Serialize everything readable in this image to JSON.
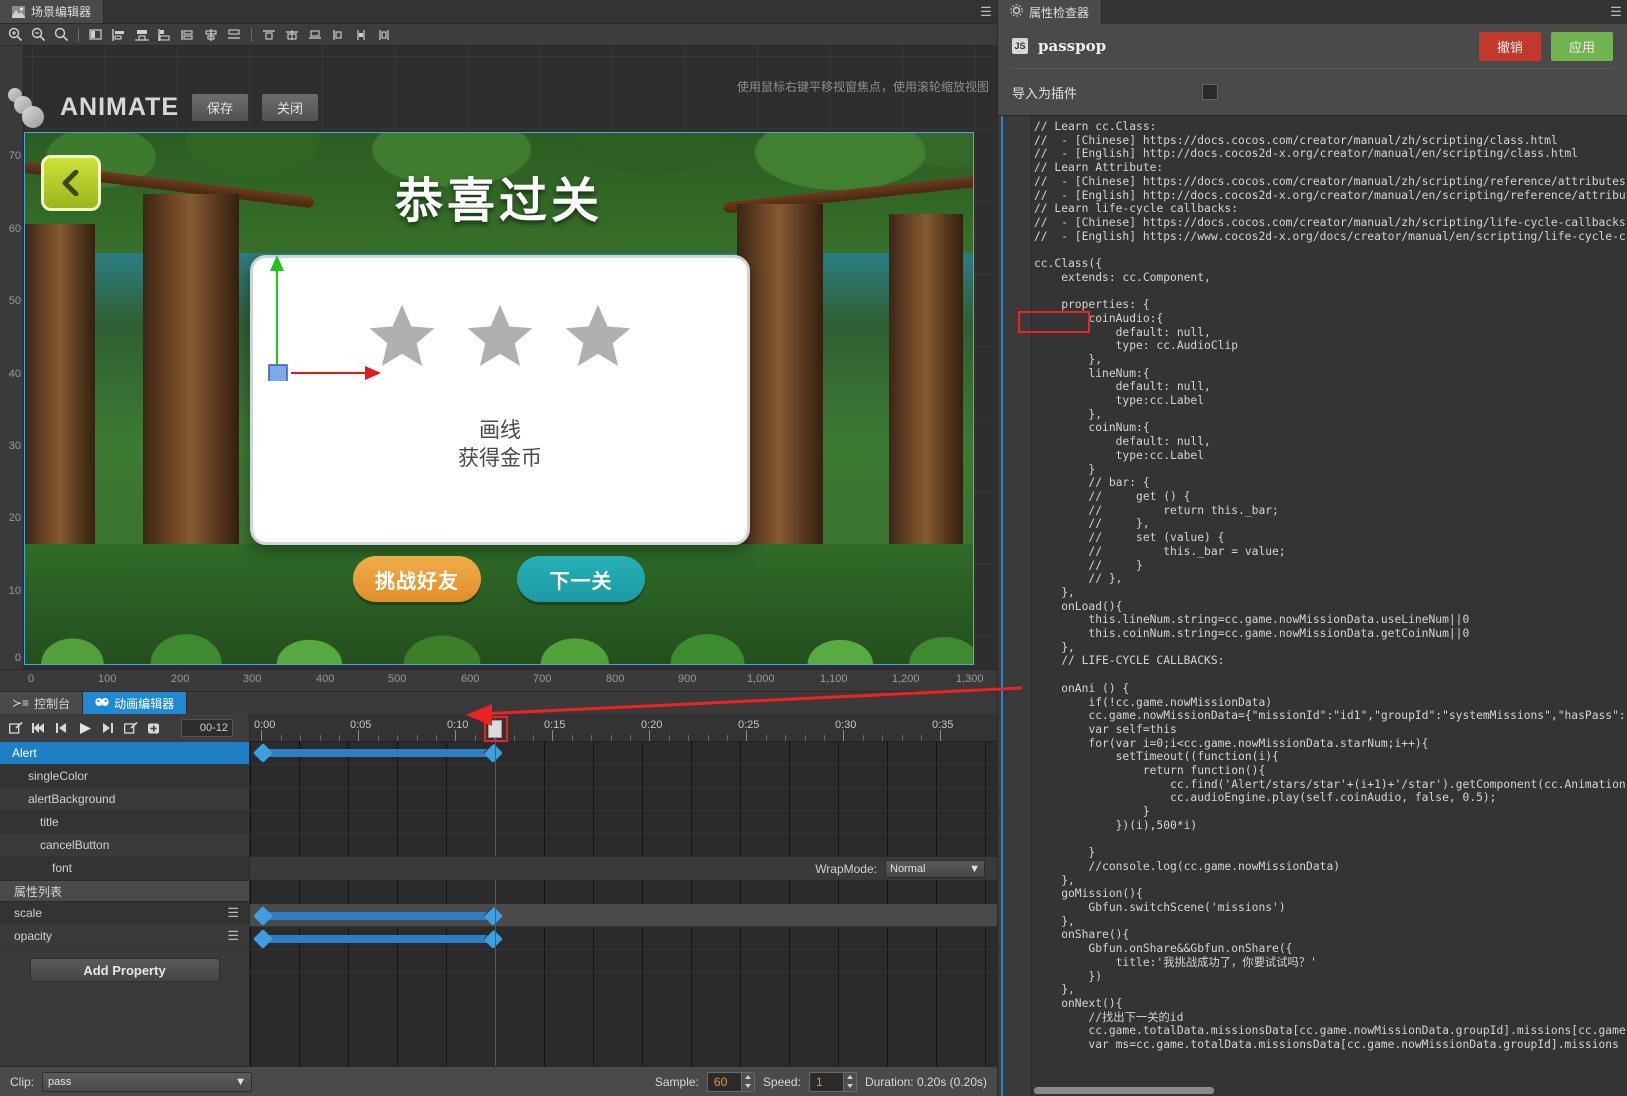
{
  "scene_panel": {
    "tab_label": "场景编辑器",
    "tab_icon": "scene-icon",
    "menu_icon": "hamburger-icon",
    "toolbar_icons": [
      "zoom-in-icon",
      "zoom-out-icon",
      "zoom-reset-icon",
      "align-left-edge-icon",
      "align-left-icon",
      "align-center-horizontal-icon",
      "align-right-icon",
      "align-top-icon",
      "align-middle-icon",
      "align-bottom-icon",
      "distribute-left-icon",
      "distribute-center-icon",
      "distribute-right-icon",
      "distribute-top-icon",
      "distribute-middle-icon",
      "distribute-bottom-icon"
    ],
    "hint_text": "使用鼠标右键平移视窗焦点，使用滚轮缩放视图",
    "animate_label": "ANIMATE",
    "save_label": "保存",
    "close_label": "关闭",
    "vertical_ruler": [
      "70",
      "60",
      "50",
      "40",
      "30",
      "20",
      "10",
      "0"
    ],
    "horizontal_ruler": [
      "0",
      "100",
      "200",
      "300",
      "400",
      "500",
      "600",
      "700",
      "800",
      "900",
      "1,000",
      "1,100",
      "1,200",
      "1,300"
    ]
  },
  "game_preview": {
    "back_button_icon": "back-arrow-icon",
    "title": "恭喜过关",
    "card_line1": "画线",
    "card_line2": "获得金币",
    "stars": 3,
    "star_color": "#b0b0b0",
    "button_challenge": "挑战好友",
    "button_next": "下一关",
    "button_challenge_color": "#eca03a",
    "button_next_color": "#22a8b0",
    "gizmo": {
      "y_axis_color": "#22c220",
      "x_axis_color": "#e01b1b",
      "handle_color": "#7ea8e8"
    }
  },
  "bottom_tabs": [
    {
      "label": "控制台",
      "icon": "console-icon",
      "active": false
    },
    {
      "label": "动画编辑器",
      "icon": "animation-icon",
      "active": true
    }
  ],
  "timeline": {
    "controls": [
      "edit-icon",
      "skip-to-start-icon",
      "prev-frame-icon",
      "play-icon",
      "next-frame-icon",
      "popout-icon",
      "add-keyframe-icon"
    ],
    "frame_field": "00-12",
    "nodes": [
      {
        "label": "Alert",
        "indent": 0,
        "selected": true
      },
      {
        "label": "singleColor",
        "indent": 1,
        "selected": false
      },
      {
        "label": "alertBackground",
        "indent": 1,
        "selected": false
      },
      {
        "label": "title",
        "indent": 2,
        "selected": false
      },
      {
        "label": "cancelButton",
        "indent": 2,
        "selected": false
      },
      {
        "label": "font",
        "indent": 3,
        "selected": false
      }
    ],
    "property_list_header": "属性列表",
    "properties": [
      {
        "label": "scale",
        "menu_icon": "drag-handle-icon"
      },
      {
        "label": "opacity",
        "menu_icon": "drag-handle-icon"
      }
    ],
    "add_property_label": "Add Property",
    "ruler_labels": [
      "0:00",
      "0:05",
      "0:10",
      "0:15",
      "0:20",
      "0:25",
      "0:30",
      "0:35"
    ],
    "wrapmode_label": "WrapMode:",
    "wrapmode_value": "Normal",
    "playhead_time": "0:10"
  },
  "statusbar": {
    "clip_label": "Clip:",
    "clip_value": "pass",
    "sample_label": "Sample:",
    "sample_value": "60",
    "speed_label": "Speed:",
    "speed_value": "1",
    "duration_text": "Duration: 0.20s (0.20s)"
  },
  "inspector": {
    "tab_label": "属性检查器",
    "tab_icon": "gear-icon",
    "menu_icon": "hamburger-icon",
    "script_badge": "JS",
    "script_name": "passpop",
    "revert_label": "撤销",
    "apply_label": "应用",
    "revert_color": "#c0392b",
    "apply_color": "#74b450",
    "plugin_field_label": "导入为插件",
    "plugin_checked": false,
    "code": "// Learn cc.Class:\n//  - [Chinese] https://docs.cocos.com/creator/manual/zh/scripting/class.html\n//  - [English] http://docs.cocos2d-x.org/creator/manual/en/scripting/class.html\n// Learn Attribute:\n//  - [Chinese] https://docs.cocos.com/creator/manual/zh/scripting/reference/attributes.html\n//  - [English] http://docs.cocos2d-x.org/creator/manual/en/scripting/reference/attributes\n// Learn life-cycle callbacks:\n//  - [Chinese] https://docs.cocos.com/creator/manual/zh/scripting/life-cycle-callbacks\n//  - [English] https://www.cocos2d-x.org/docs/creator/manual/en/scripting/life-cycle-c\n\ncc.Class({\n    extends: cc.Component,\n\n    properties: {\n        coinAudio:{\n            default: null,\n            type: cc.AudioClip\n        },\n        lineNum:{\n            default: null,\n            type:cc.Label\n        },\n        coinNum:{\n            default: null,\n            type:cc.Label\n        }\n        // bar: {\n        //     get () {\n        //         return this._bar;\n        //     },\n        //     set (value) {\n        //         this._bar = value;\n        //     }\n        // },\n    },\n    onLoad(){\n        this.lineNum.string=cc.game.nowMissionData.useLineNum||0\n        this.coinNum.string=cc.game.nowMissionData.getCoinNum||0\n    },\n    // LIFE-CYCLE CALLBACKS:\n\n    onAni () {\n        if(!cc.game.nowMissionData)\n        cc.game.nowMissionData={\"missionId\":\"id1\",\"groupId\":\"systemMissions\",\"hasPass\":\n        var self=this\n        for(var i=0;i<cc.game.nowMissionData.starNum;i++){\n            setTimeout((function(i){\n                return function(){\n                    cc.find('Alert/stars/star'+(i+1)+'/star').getComponent(cc.Animation\n                    cc.audioEngine.play(self.coinAudio, false, 0.5);\n                }\n            })(i),500*i)\n\n        }\n        //console.log(cc.game.nowMissionData)\n    },\n    goMission(){\n        Gbfun.switchScene('missions')\n    },\n    onShare(){\n        Gbfun.onShare&&Gbfun.onShare({\n            title:'我挑战成功了，你要试试吗？'\n        })\n    },\n    onNext(){\n        //找出下一关的id\n        cc.game.totalData.missionsData[cc.game.nowMissionData.groupId].missions[cc.game\n        var ms=cc.game.totalData.missionsData[cc.game.nowMissionData.groupId].missions"
  },
  "annotation": {
    "arrow_color": "#ee2222",
    "highlight_code": "onAni () {",
    "highlight_timeline_frame": "0:10"
  }
}
